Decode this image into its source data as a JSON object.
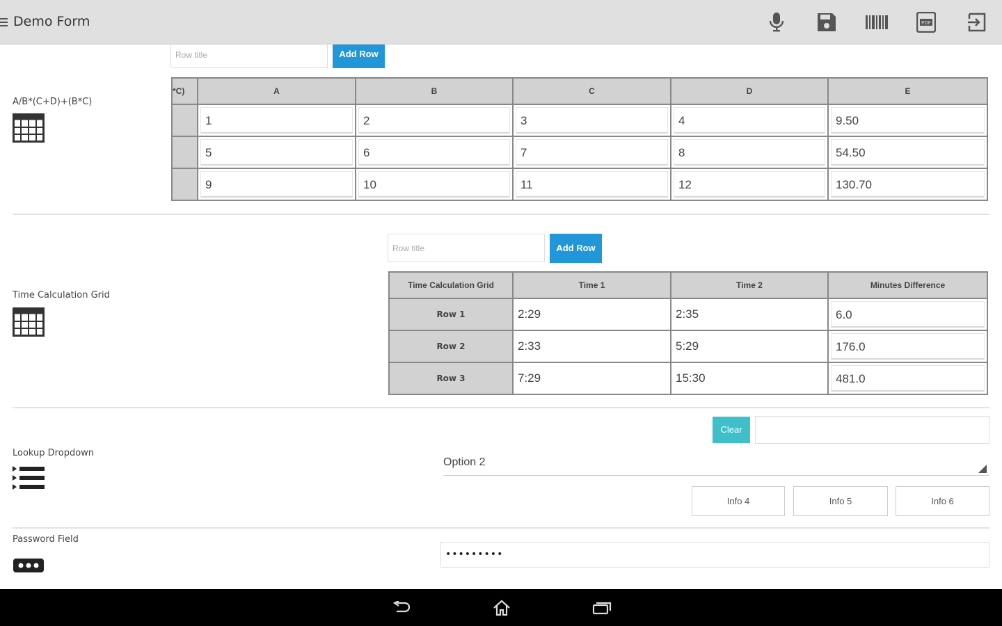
{
  "app": {
    "title": "Demo Form",
    "toolbar_icons": [
      "microphone-icon",
      "save-icon",
      "barcode-icon",
      "pdf-icon",
      "exit-icon"
    ]
  },
  "formula_grid": {
    "label": "A/B*(C+D)+(B*C)",
    "row_title_placeholder": "Row title",
    "add_row_label": "Add Row",
    "corner_header": "*C)",
    "columns": [
      "A",
      "B",
      "C",
      "D",
      "E"
    ],
    "rows": [
      [
        "1",
        "2",
        "3",
        "4",
        "9.50"
      ],
      [
        "5",
        "6",
        "7",
        "8",
        "54.50"
      ],
      [
        "9",
        "10",
        "11",
        "12",
        "130.70"
      ]
    ]
  },
  "time_grid": {
    "label": "Time Calculation Grid",
    "row_title_placeholder": "Row title",
    "add_row_label": "Add Row",
    "columns": [
      "Time Calculation Grid",
      "Time 1",
      "Time 2",
      "Minutes Difference"
    ],
    "rows": [
      {
        "name": "Row 1",
        "time1": "2:29",
        "time2": "2:35",
        "diff": "6.0"
      },
      {
        "name": "Row 2",
        "time1": "2:33",
        "time2": "5:29",
        "diff": "176.0"
      },
      {
        "name": "Row 3",
        "time1": "7:29",
        "time2": "15:30",
        "diff": "481.0"
      }
    ]
  },
  "lookup": {
    "label": "Lookup Dropdown",
    "clear_label": "Clear",
    "selected": "Option 2",
    "info_buttons": [
      "Info 4",
      "Info 5",
      "Info 6"
    ]
  },
  "password": {
    "label": "Password Field",
    "value": "•••••••••"
  },
  "colors": {
    "accent": "#2196d8",
    "clear_button": "#3ebfc9",
    "action_bar": "#e0e0e0",
    "grid_header": "#d2d2d2"
  },
  "nav_icons": [
    "back-icon",
    "home-icon",
    "recent-apps-icon"
  ]
}
